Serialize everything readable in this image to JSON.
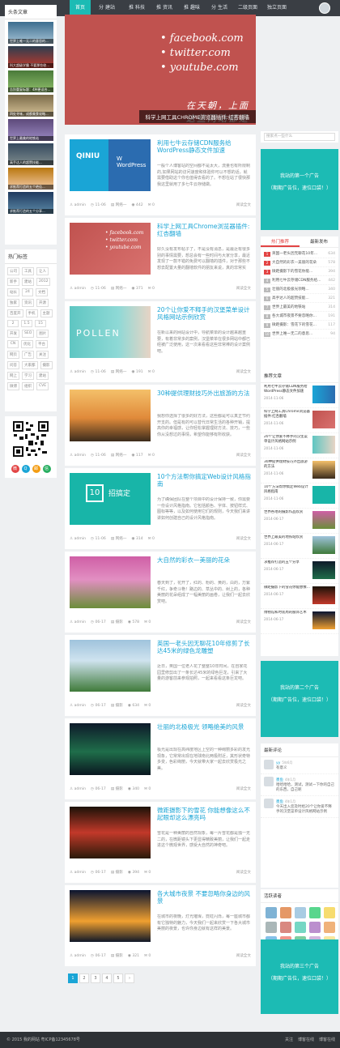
{
  "nav": {
    "items": [
      {
        "label": "首页"
      },
      {
        "label": "分 建站"
      },
      {
        "label": "推 科技"
      },
      {
        "label": "推 资讯"
      },
      {
        "label": "推 趣味"
      },
      {
        "label": "分 生活"
      },
      {
        "label": "二级页面"
      },
      {
        "label": "独立页面"
      }
    ]
  },
  "left": {
    "headline_title": "头条文章",
    "headlines": [
      {
        "caption": "世界上唯一无二的意思的..."
      },
      {
        "caption": "科大超级学霸 不要那些收..."
      },
      {
        "caption": "告别重复标题：4种更适合..."
      },
      {
        "caption": "四处寻味，成都美食攻略..."
      },
      {
        "caption": "世界上最美的地铁站"
      },
      {
        "caption": "高手达人的超赞技能..."
      },
      {
        "caption": "求推荐打造的五个绝佳..."
      },
      {
        "caption": "求推荐打造的五个分享..."
      }
    ],
    "tags_title": "热门标签",
    "tags": [
      "公司",
      "工具",
      "让人",
      "新手",
      "建站",
      "2012",
      "站长",
      "24",
      "文档",
      "独家",
      "资讯",
      "开源",
      "百度开",
      "手机",
      "主题",
      "2",
      "1.5",
      "15",
      "开发",
      "SEO",
      "图片",
      "CN",
      "优化",
      "平台",
      "网页",
      "广告",
      "关注",
      "问答",
      "大家都",
      "摄影",
      "网上",
      "学习",
      "建站",
      "微博",
      "组织",
      "CVE"
    ],
    "socials": [
      "微",
      "Q",
      "邮",
      "信"
    ]
  },
  "slider": {
    "lines": [
      "• facebook.com",
      "• twitter.com",
      "• youtube.com"
    ],
    "cn": "在天朝，上面这些网站都是不存在的",
    "caption": "科学上网工具CHROME浏览器插件:红杏翻墙"
  },
  "posts": [
    {
      "title": "利用七牛云存储CDN服务给WordPress静态文件加速",
      "excerpt": "一般个人博客站的空间都不是太大，流量也有所限制的,如果网站的访问速度和体验你可以不想的话，就需要借助这个你也值得去看的了。不想在站了很快那我这里就用了多七牛云存储做。",
      "author": "admin",
      "date": "11-06",
      "cat": "网络一",
      "views": "442",
      "comments": "0",
      "more": "阅读全文"
    },
    {
      "title": "科学上网工具Chrome浏览器插件:红杏翻墙",
      "excerpt": "好久没有发布帖子了，不是没有消息，是最近有很多别的事情需要，想总会有一些时间与大家分享，最近发现了一款不错的免费可以翻墙的插件，对于那些不想去配置大量的翻墙软件的朋友来说，真的非常实用。",
      "author": "admin",
      "date": "11-06",
      "cat": "网络一",
      "views": "371",
      "comments": "0",
      "more": "阅读全文"
    },
    {
      "title": "20个让你爱不释手的汉堡菜单设计风格网站示例欣赏",
      "excerpt": "在新以来的网站设计中，导航菜单的设计越来越重要，有着非常多的案例，汉堡菜单在很多网站中都已经被广泛使用，这一次来看看这些非常棒的设计案例吧。",
      "author": "admin",
      "date": "11-06",
      "cat": "网络一",
      "views": "191",
      "comments": "0",
      "more": "阅读全文"
    },
    {
      "title": "30种提供理财技巧外出旅游的方法",
      "excerpt": "我想你选择了很多的好方法，这些都是可以真正节约开支的。但是有的可以替代日常生活的各种开销，提高你的幸福感，让你轻松掌握理财方法、技巧，一些你从没想过的事情，希望你能够有所收获。",
      "author": "admin",
      "date": "11-06",
      "cat": "网络一",
      "views": "117",
      "comments": "0",
      "more": "阅读全文"
    },
    {
      "title": "10个方法帮你搞定Web设计风格指南",
      "excerpt": "为了确保团队在整个项目中的设计保持一致，你需要一份设计风格指南。它包括颜色、字体、按钮样式、图标等等，以及如何使用它们的规则，今天我们来讲讲如何创建自己的设计风格指南。",
      "author": "admin",
      "date": "11-06",
      "cat": "网络一",
      "views": "314",
      "comments": "0",
      "more": "阅读全文"
    },
    {
      "title": "大自然的彩衣—美丽的花朵",
      "excerpt": "春天到了，花开了，红的、粉的、黄的，白的，万紫千红，争奇斗艳！路边的、草丛中的、树上的，各种美丽的花朵组成了一幅美丽的画卷，让我们一起去欣赏吧。",
      "author": "admin",
      "date": "06-17",
      "cat": "摄影",
      "views": "578",
      "comments": "0",
      "more": "阅读全文"
    },
    {
      "title": "英国一老头因无聊花10年修剪了长达45米的绿色龙雕塑",
      "excerpt": "近日，英国一位老人花了整整10年时间，在自家花园里修剪出了一条长达45米的绿色巨龙，引来了大量的游客前来参观拍照，一起来看看这条巨龙吧。",
      "author": "admin",
      "date": "06-17",
      "cat": "摄影",
      "views": "634",
      "comments": "0",
      "more": "阅读全文"
    },
    {
      "title": "壮丽的北极极光 领略绝美的风景",
      "excerpt": "极光是出现在高纬度地区上空的一种绚丽多彩的发光现象，它常常出现在地球南北两极附近，其形状奇特多变，色彩绚丽，今天就带大家一起去欣赏极光之美。",
      "author": "admin",
      "date": "06-17",
      "cat": "摄影",
      "views": "340",
      "comments": "0",
      "more": "阅读全文"
    },
    {
      "title": "微距摄影下的雪花 你能想像这么不起眼却这么漂亮吗",
      "excerpt": "雪花是一种美丽的自然现象，每一片雪花都是独一无二的，在微距镜头下更显得精致美丽，让我们一起走进这个微观世界，感受大自然的神奇吧。",
      "author": "admin",
      "date": "06-17",
      "cat": "摄影",
      "views": "394",
      "comments": "0",
      "more": "阅读全文"
    },
    {
      "title": "各大城市夜景 不要忽略你身边的风景",
      "excerpt": "在城市的夜晚，灯光璀璨，霓虹闪烁，每一座城市都有它独特的魅力，今天我们一起来欣赏一下各大城市美丽的夜景，也许你身边就有这样的美景。",
      "author": "admin",
      "date": "06-17",
      "cat": "摄影",
      "views": "321",
      "comments": "0",
      "more": "阅读全文"
    }
  ],
  "pager": {
    "pages": [
      "1",
      "2",
      "3",
      "4",
      "5",
      "›"
    ]
  },
  "right": {
    "search_placeholder": "搜索点一些什么",
    "search_btn": "Q",
    "ad1": {
      "l1": "我站的第一个广告",
      "l2": "（期期广告位，速位口袋！）"
    },
    "tabs": [
      "热门推荐",
      "最新发布"
    ],
    "ranks": [
      {
        "t": "英国一老头因无聊花10年...",
        "c": "634"
      },
      {
        "t": "大自然的彩衣—美丽的花朵",
        "c": "578"
      },
      {
        "t": "微距摄影下的雪花你能...",
        "c": "394"
      },
      {
        "t": "利用七牛云存储CDN服务给...",
        "c": "442"
      },
      {
        "t": "壮丽的北极极光领略...",
        "c": "340"
      },
      {
        "t": "高手达人的超赞技能...",
        "c": "321"
      },
      {
        "t": "世界上最美的地铁站",
        "c": "314"
      },
      {
        "t": "各大城市夜景不要忽略你...",
        "c": "191"
      },
      {
        "t": "微距摄影：雪花下的雪花...",
        "c": "117"
      },
      {
        "t": "世界上唯一无二的意思...",
        "c": "94"
      }
    ],
    "rec_title": "推荐文章",
    "recs": [
      {
        "t": "利用七牛云存储CDN服务给WordPress静态文件加速",
        "d": "2014-11-06"
      },
      {
        "t": "科学上网工具Chrome浏览器插件:红杏翻墙",
        "d": "2014-11-06"
      },
      {
        "t": "20个让你爱不释手的汉堡菜单设计风格网站示例",
        "d": "2014-11-06"
      },
      {
        "t": "30种提供理财技巧外出旅游的方法",
        "d": "2014-11-06"
      },
      {
        "t": "10个方法帮你搞定Web设计风格指南",
        "d": "2014-11-06"
      },
      {
        "t": "世界各地的摄影作品欣赏",
        "d": "2014-06-17"
      },
      {
        "t": "世界上最美的地铁站欣赏",
        "d": "2014-06-17"
      },
      {
        "t": "求推荐打造的五个分享",
        "d": "2014-06-17"
      },
      {
        "t": "微距摄影下的雪花你能想像...",
        "d": "2014-06-17"
      },
      {
        "t": "博物馆和时装周的服饰艺术",
        "d": "2014-06-17"
      }
    ],
    "ad2": {
      "l1": "我站的第二个广告",
      "l2": "（期期广告位，速位口袋！）"
    },
    "cmt_title": "最新评论",
    "cmts": [
      {
        "n": "yy",
        "d": "5年6月",
        "t": "有意义"
      },
      {
        "n": "墨鱼",
        "d": "4年1月",
        "t": "哈哈哈哈，测试，测试一下你的自己的东西，自己呢"
      },
      {
        "n": "墨鱼",
        "d": "4年1月",
        "t": "今天出入您及时给20个让你爱不释手的汉堡菜单设计风格网站示例"
      }
    ],
    "vis_title": "活跃读者",
    "visitors": [
      "#7fb3d5",
      "#e59866",
      "#a9cce3",
      "#58d68d",
      "#f7dc6f",
      "#aab7b8",
      "#d98880",
      "#76d7c4",
      "#bb8fce",
      "#f0b27a",
      "#85c1e9",
      "#f1948a",
      "#7dcea0",
      "#d2b4de",
      "#f9e79f"
    ],
    "ad3": {
      "l1": "我站的第三个广告",
      "l2": "（期期广告位，速位口袋！）"
    }
  },
  "footer": {
    "copy": "© 2015 我的网站  粤ICP备12345678号",
    "links": [
      "关注",
      "博客在线",
      "博客在线"
    ]
  },
  "colors": {
    "accent": "#1cbbb4",
    "link": "#1aa5d6",
    "nav": "#3a3e44",
    "hot": "#e24444",
    "slider": "#c0524f"
  }
}
